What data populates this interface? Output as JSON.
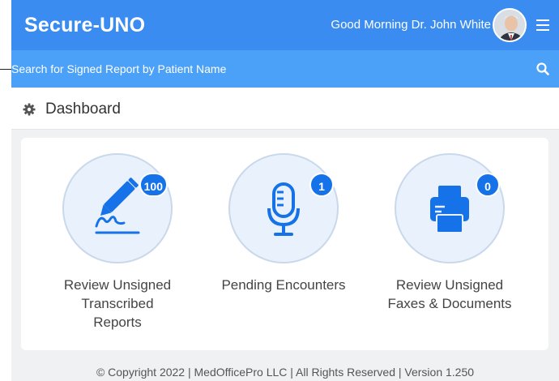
{
  "header": {
    "brand": "Secure-UNO",
    "greeting": "Good Morning Dr. John White"
  },
  "search": {
    "placeholder": "Search for Signed Report by Patient Name"
  },
  "dashboard": {
    "title": "Dashboard",
    "tiles": [
      {
        "label_lines": [
          "Review Unsigned",
          "Transcribed",
          "Reports"
        ],
        "badge": "100",
        "icon": "pen-signature-icon"
      },
      {
        "label_lines": [
          "Pending Encounters"
        ],
        "badge": "1",
        "icon": "microphone-icon"
      },
      {
        "label_lines": [
          "Review Unsigned",
          "Faxes & Documents"
        ],
        "badge": "0",
        "icon": "printer-icon"
      }
    ]
  },
  "footer": {
    "text": "© Copyright 2022 | MedOfficePro LLC | All Rights Reserved | Version 1.250"
  },
  "colors": {
    "topbar": "#3b8cf0",
    "searchbar": "#4ba0f7",
    "icon": "#1572e8",
    "badge": "#1572e8"
  }
}
